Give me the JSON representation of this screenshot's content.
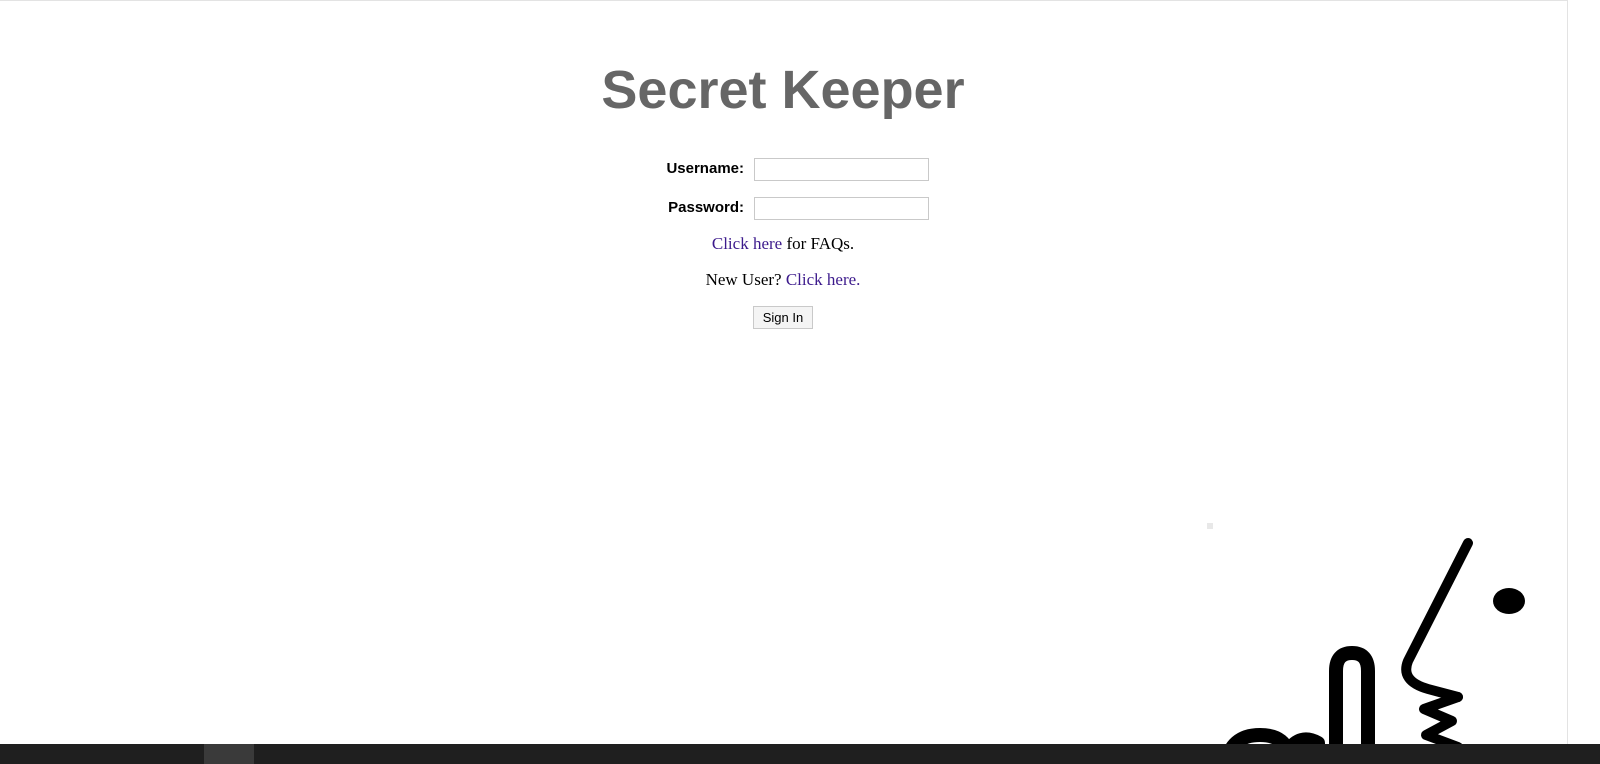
{
  "page": {
    "title": "Secret Keeper"
  },
  "login_form": {
    "username_label": "Username:",
    "username_value": "",
    "password_label": "Password:",
    "password_value": ""
  },
  "faq_line": {
    "link_text": "Click here",
    "suffix": " for FAQs."
  },
  "new_user_line": {
    "prefix": "New User? ",
    "link_text": "Click here."
  },
  "sign_in_button": {
    "label": "Sign In"
  },
  "colors": {
    "title": "#666666",
    "link": "#3c1a8c",
    "taskbar": "#1f1f1f"
  }
}
